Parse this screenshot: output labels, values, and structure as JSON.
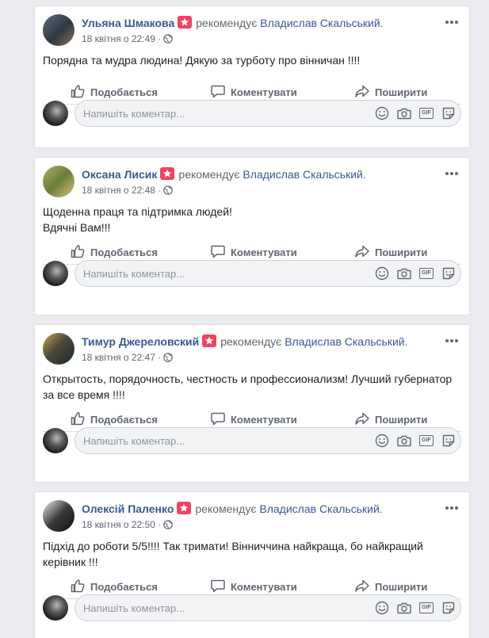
{
  "composer_placeholder": "Напишіть коментар...",
  "actions": {
    "like": "Подобається",
    "comment": "Коментувати",
    "share": "Поширити"
  },
  "verb": "рекомендує",
  "target": "Владислав Скальський.",
  "gif_label": "GIF",
  "icons": [
    "star-icon",
    "globe-icon",
    "more-icon",
    "like-icon",
    "comment-icon",
    "share-icon",
    "emoji-icon",
    "camera-icon",
    "gif-icon",
    "sticker-icon"
  ],
  "colors": {
    "link": "#385898",
    "badge": "#f3425f",
    "muted": "#606770",
    "background": "#e9ebee"
  },
  "posts": [
    {
      "name": "Ульяна Шмакова",
      "time": "18 квітня о 22:49",
      "lines": [
        "Порядна та мудра людина! Дякую за турботу про вінничан !!!!"
      ]
    },
    {
      "name": "Оксана Лисик",
      "time": "18 квітня о 22:48",
      "lines": [
        "Щоденна праця та підтримка людей!",
        "Вдячні Вам!!!"
      ]
    },
    {
      "name": "Тимур Джереловский",
      "time": "18 квітня о 22:47",
      "lines": [
        "Открытость, порядочность, честность и профессионализм! Лучший губернатор",
        "за все время !!!!"
      ]
    },
    {
      "name": "Олексій Паленко",
      "time": "18 квітня о 22:50",
      "lines": [
        "Підхід до роботи 5/5!!!! Так тримати! Вінниччина найкраща, бо найкращий",
        "керівник !!!"
      ]
    }
  ]
}
